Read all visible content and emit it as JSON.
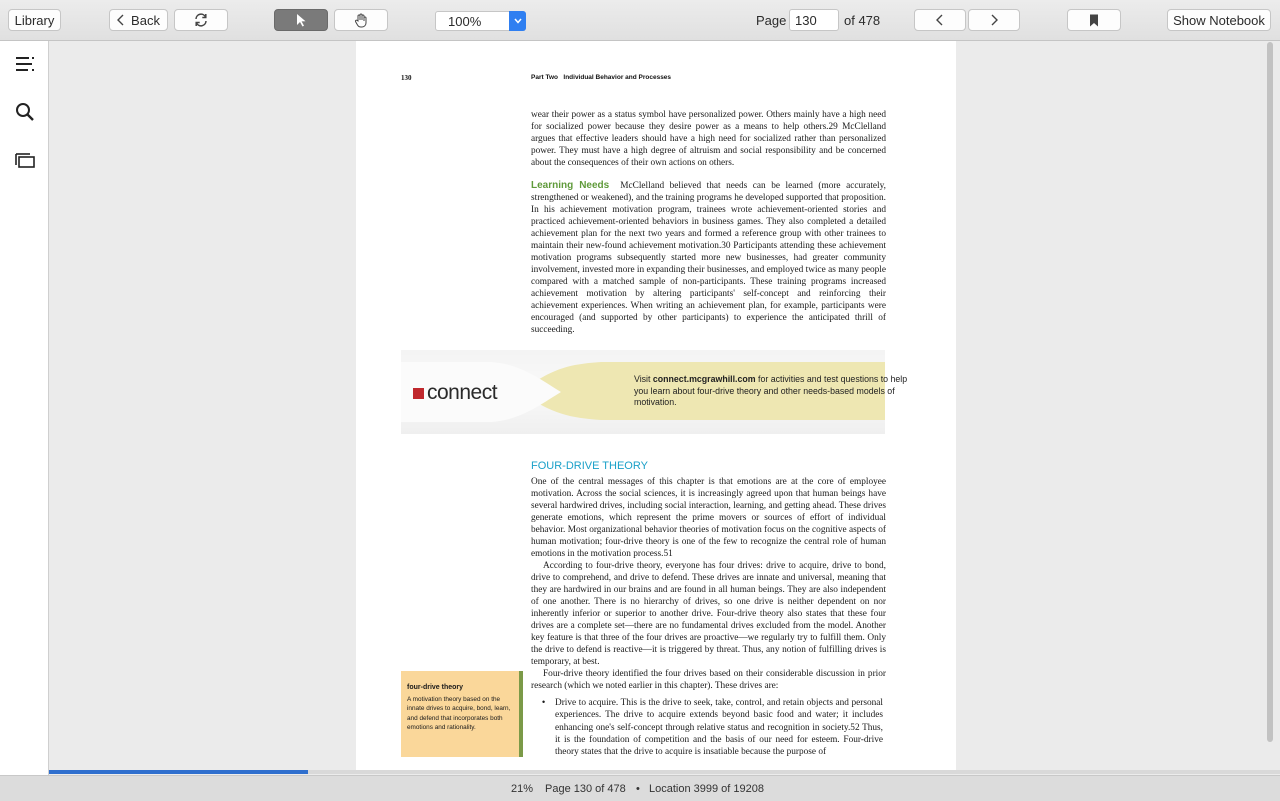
{
  "toolbar": {
    "library_label": "Library",
    "back_label": "Back",
    "zoom_value": "100%",
    "page_label": "Page",
    "page_value": "130",
    "page_of": "of 478",
    "notebook_label": "Show Notebook"
  },
  "sidebar": {
    "items": [
      {
        "icon": "table-of-contents-icon"
      },
      {
        "icon": "search-icon"
      },
      {
        "icon": "pages-icon"
      }
    ]
  },
  "page": {
    "page_number": "130",
    "running_head_part": "Part Two",
    "running_head_title": "Individual Behavior and Processes",
    "para1": "wear their power as a status symbol have personalized power. Others mainly have a high need for socialized power because they desire power as a means to help others.29 McClelland argues that effective leaders should have a high need for socialized rather than personalized power. They must have a high degree of altruism and social responsibility and be concerned about the consequences of their own actions on others.",
    "learning_heading": "Learning Needs",
    "para2": "McClelland believed that needs can be learned (more accurately, strengthened or weakened), and the training programs he developed supported that proposition. In his achievement motivation program, trainees wrote achievement-oriented stories and practiced achievement-oriented behaviors in business games. They also completed a detailed achievement plan for the next two years and formed a reference group with other trainees to maintain their new-found achievement motivation.30 Participants attending these achievement motivation programs subsequently started more new businesses, had greater community involvement, invested more in expanding their businesses, and employed twice as many people compared with a matched sample of non-participants. These training programs increased achievement motivation by altering participants' self-concept and reinforcing their achievement experiences. When writing an achievement plan, for example, participants were encouraged (and supported by other participants) to experience the anticipated thrill of succeeding.",
    "connect_logo": "connect",
    "connect_text_pre": "Visit ",
    "connect_url": "connect.mcgrawhill.com",
    "connect_text_post": " for activities and test questions to help you learn about four-drive theory and other needs-based models of motivation.",
    "section_title": "FOUR-DRIVE THEORY",
    "para3": "One of the central messages of this chapter is that emotions are at the core of employee motivation. Across the social sciences, it is increasingly agreed upon that human beings have several hardwired drives, including social interaction, learning, and getting ahead. These drives generate emotions, which represent the prime movers or sources of effort of individual behavior. Most organizational behavior theories of motivation focus on the cognitive aspects of human motivation; four-drive theory is one of the few to recognize the central role of human emotions in the motivation process.51",
    "para4": "According to four-drive theory, everyone has four drives: drive to acquire, drive to bond, drive to comprehend, and drive to defend. These drives are innate and universal, meaning that they are hardwired in our brains and are found in all human beings. They are also independent of one another. There is no hierarchy of drives, so one drive is neither dependent on nor inherently inferior or superior to another drive. Four-drive theory also states that these four drives are a complete set—there are no fundamental drives excluded from the model. Another key feature is that three of the four drives are proactive—we regularly try to fulfill them. Only the drive to defend is reactive—it is triggered by threat. Thus, any notion of fulfilling drives is temporary, at best.",
    "para5": "Four-drive theory identified the four drives based on their considerable discussion in prior research (which we noted earlier in this chapter). These drives are:",
    "bullet1": "Drive to acquire. This is the drive to seek, take, control, and retain objects and personal experiences. The drive to acquire extends beyond basic food and water; it includes enhancing one's self-concept through relative status and recognition in society.52 Thus, it is the foundation of competition and the basis of our need for esteem. Four-drive theory states that the drive to acquire is insatiable because the purpose of",
    "gloss_term": "four-drive theory",
    "gloss_def": "A motivation theory based on the innate drives to acquire, bond, learn, and defend that incorporates both emotions and rationality."
  },
  "status": {
    "percent": "21%",
    "page_text": "Page 130 of 478",
    "separator": "•",
    "location_text": "Location 3999 of 19208",
    "progress_fraction": 0.21
  }
}
